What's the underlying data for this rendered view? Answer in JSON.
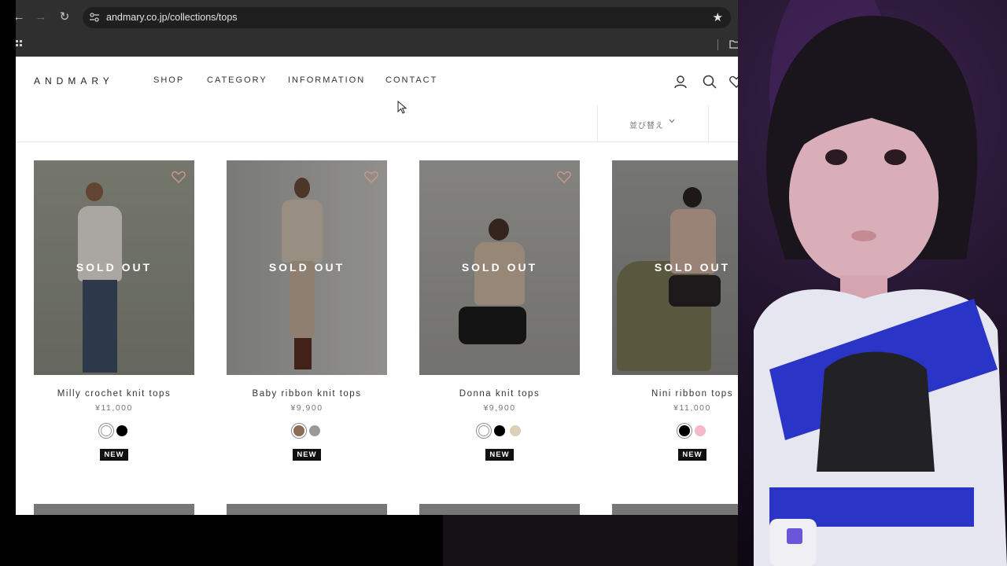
{
  "browser": {
    "url": "andmary.co.jp/collections/tops"
  },
  "site": {
    "logo": "ANDMARY",
    "menu": [
      "SHOP",
      "CATEGORY",
      "INFORMATION",
      "CONTACT"
    ],
    "sort_label": "並び替え"
  },
  "products": [
    {
      "name": "Milly crochet knit tops",
      "price": "¥11,000",
      "status": "SOLD OUT",
      "badge": "NEW",
      "swatches": [
        "#ffffff",
        "#000000"
      ]
    },
    {
      "name": "Baby ribbon knit tops",
      "price": "¥9,900",
      "status": "SOLD OUT",
      "badge": "NEW",
      "swatches": [
        "#8a6b55",
        "#9a9a9a"
      ]
    },
    {
      "name": "Donna knit tops",
      "price": "¥9,900",
      "status": "SOLD OUT",
      "badge": "NEW",
      "swatches": [
        "#ffffff",
        "#000000",
        "#ddd0b8"
      ]
    },
    {
      "name": "Nini ribbon tops",
      "price": "¥11,000",
      "status": "SOLD OUT",
      "badge": "NEW",
      "swatches": [
        "#000000",
        "#f4b8c8"
      ]
    }
  ],
  "colors": {
    "browser_chrome": "#2f2f2f",
    "url_field": "#1f1f1f",
    "badge": "#111111",
    "sold_out_overlay": "rgba(0,0,0,0.28)"
  }
}
